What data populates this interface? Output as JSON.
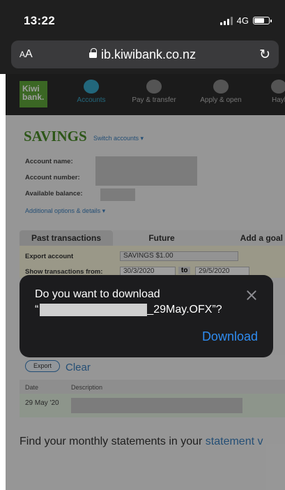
{
  "status_bar": {
    "time": "13:22",
    "network": "4G"
  },
  "browser": {
    "text_size_label": "AA",
    "url": "ib.kiwibank.co.nz"
  },
  "nav": {
    "logo_line1": "Kiwi",
    "logo_line2": "bank.",
    "items": [
      {
        "label": "Accounts",
        "active": true
      },
      {
        "label": "Pay & transfer"
      },
      {
        "label": "Apply & open"
      },
      {
        "label": "Hayl"
      }
    ]
  },
  "account": {
    "title": "SAVINGS",
    "switch_label": "Switch accounts ▾",
    "name_label": "Account name:",
    "number_label": "Account number:",
    "balance_label": "Available balance:",
    "options_link": "Additional options & details ▾"
  },
  "tabs": [
    "Past transactions",
    "Future",
    "Add a goal"
  ],
  "export": {
    "account_label": "Export account",
    "account_value": "SAVINGS $1.00",
    "show_label": "Show transactions from:",
    "date_from": "30/3/2020",
    "to_label": "to",
    "date_to": "29/5/2020",
    "export_button": "Export",
    "clear_link": "Clear"
  },
  "table": {
    "columns": [
      "Date",
      "Description"
    ],
    "rows": [
      {
        "date": "29 May '20"
      }
    ]
  },
  "statements_text": "Find your monthly statements in your ",
  "statements_link": "statement v",
  "dialog": {
    "question_line1": "Do you want to download",
    "filename_prefix": "“",
    "filename_suffix": "_29May.OFX”?",
    "download_button": "Download"
  }
}
